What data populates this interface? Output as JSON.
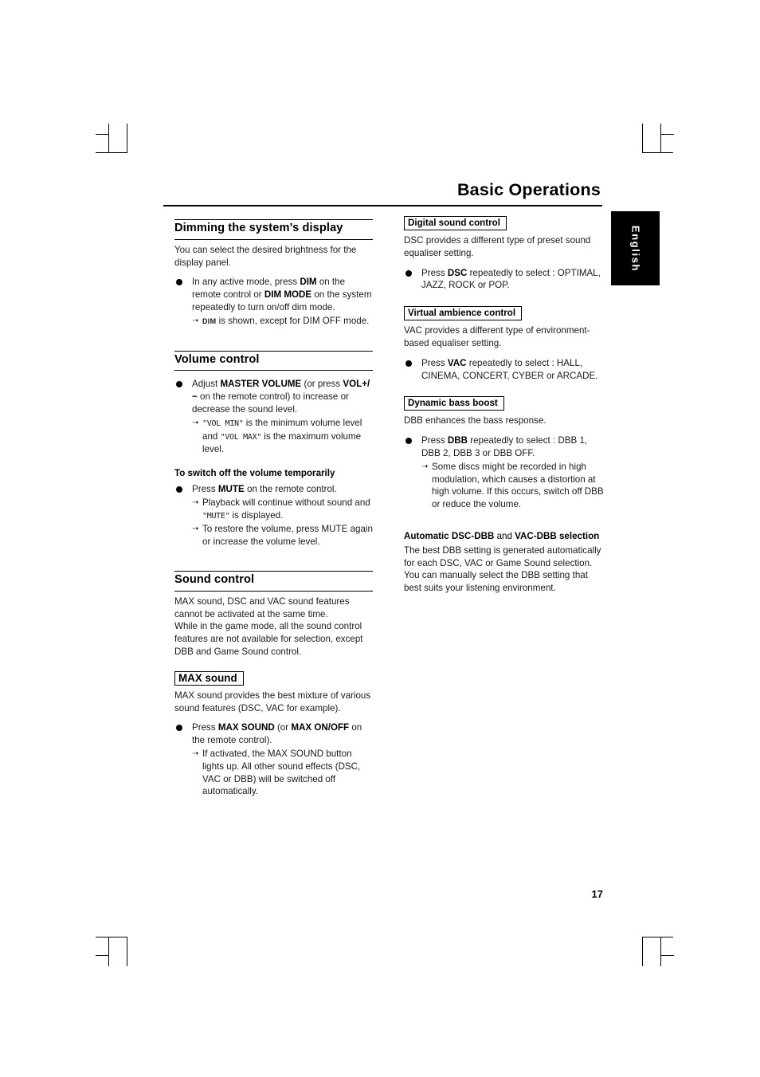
{
  "page": {
    "title": "Basic Operations",
    "language_tab": "English",
    "page_number": "17"
  },
  "left_column": {
    "section1": {
      "heading": "Dimming the system’s display",
      "intro": "You can select the desired brightness for the display panel.",
      "bullet1_part1": "In any active mode, press ",
      "bullet1_bold1": "DIM",
      "bullet1_part2": " on the remote control or ",
      "bullet1_bold2": "DIM MODE",
      "bullet1_part3": " on the system repeatedly to turn on/off dim mode.",
      "arrow1_bold": "DIM",
      "arrow1_text": " is shown, except for DIM OFF mode."
    },
    "section2": {
      "heading": "Volume control",
      "bullet1_part1": "Adjust ",
      "bullet1_bold1": "MASTER VOLUME",
      "bullet1_part2": " (or press ",
      "bullet1_bold2": "VOL",
      "bullet1_bold3": "+/−",
      "bullet1_part3": " on the remote control) to increase or decrease the sound level.",
      "arrow1_pre": "",
      "arrow1_mono1": "\"VOL MIN\"",
      "arrow1_mid": " is the minimum volume level and ",
      "arrow1_mono2": "\"VOL MAX\"",
      "arrow1_end": " is the maximum volume level.",
      "sub_heading": "To switch off the volume temporarily",
      "bullet2_part1": "Press ",
      "bullet2_bold": "MUTE",
      "bullet2_part2": " on the remote control.",
      "arrow2_pre": "Playback will continue without sound and ",
      "arrow2_mono": "\"MUTE\"",
      "arrow2_end": " is displayed.",
      "arrow3": "To restore the volume, press MUTE again or increase the volume level."
    },
    "section3": {
      "heading": "Sound control",
      "para1": "MAX sound, DSC and VAC sound features cannot be activated at the same time.",
      "para2": "While in the game mode, all the sound control features are not available for selection, except DBB and Game Sound control.",
      "box_heading": "MAX sound",
      "para3": "MAX sound provides the best mixture of various sound features (DSC, VAC for example).",
      "bullet1_part1": "Press ",
      "bullet1_bold1": "MAX SOUND",
      "bullet1_part2": " (or ",
      "bullet1_bold2": "MAX ON/OFF",
      "bullet1_part3": " on the remote control).",
      "arrow1": "If activated, the MAX SOUND button lights up.  All other sound effects (DSC, VAC or DBB) will be switched off automatically."
    }
  },
  "right_column": {
    "section1": {
      "box_heading": "Digital sound control",
      "para1": "DSC provides a different type of preset sound equaliser setting.",
      "bullet1_part1": "Press ",
      "bullet1_bold": "DSC",
      "bullet1_part2": " repeatedly to select : OPTIMAL, JAZZ, ROCK or POP."
    },
    "section2": {
      "box_heading": "Virtual ambience control",
      "para1": "VAC provides a different type of environment-based equaliser setting.",
      "bullet1_part1": "Press ",
      "bullet1_bold": "VAC",
      "bullet1_part2": " repeatedly to select : HALL, CINEMA, CONCERT, CYBER or ARCADE."
    },
    "section3": {
      "box_heading": "Dynamic bass boost",
      "para1": "DBB enhances the bass response.",
      "bullet1_part1": "Press ",
      "bullet1_bold": "DBB",
      "bullet1_part2": " repeatedly to select : DBB 1, DBB 2, DBB 3 or DBB OFF.",
      "arrow1": "Some discs might be recorded in high modulation, which causes a distortion at high volume. If this occurs, switch off DBB or reduce the volume."
    },
    "section4": {
      "heading_part1": "Automatic DSC-DBB ",
      "heading_and": "and",
      "heading_part2": " VAC-DBB selection",
      "para1": "The best DBB setting is generated automatically for each DSC, VAC or Game Sound selection. You can manually select the DBB setting that best suits your listening environment."
    }
  }
}
